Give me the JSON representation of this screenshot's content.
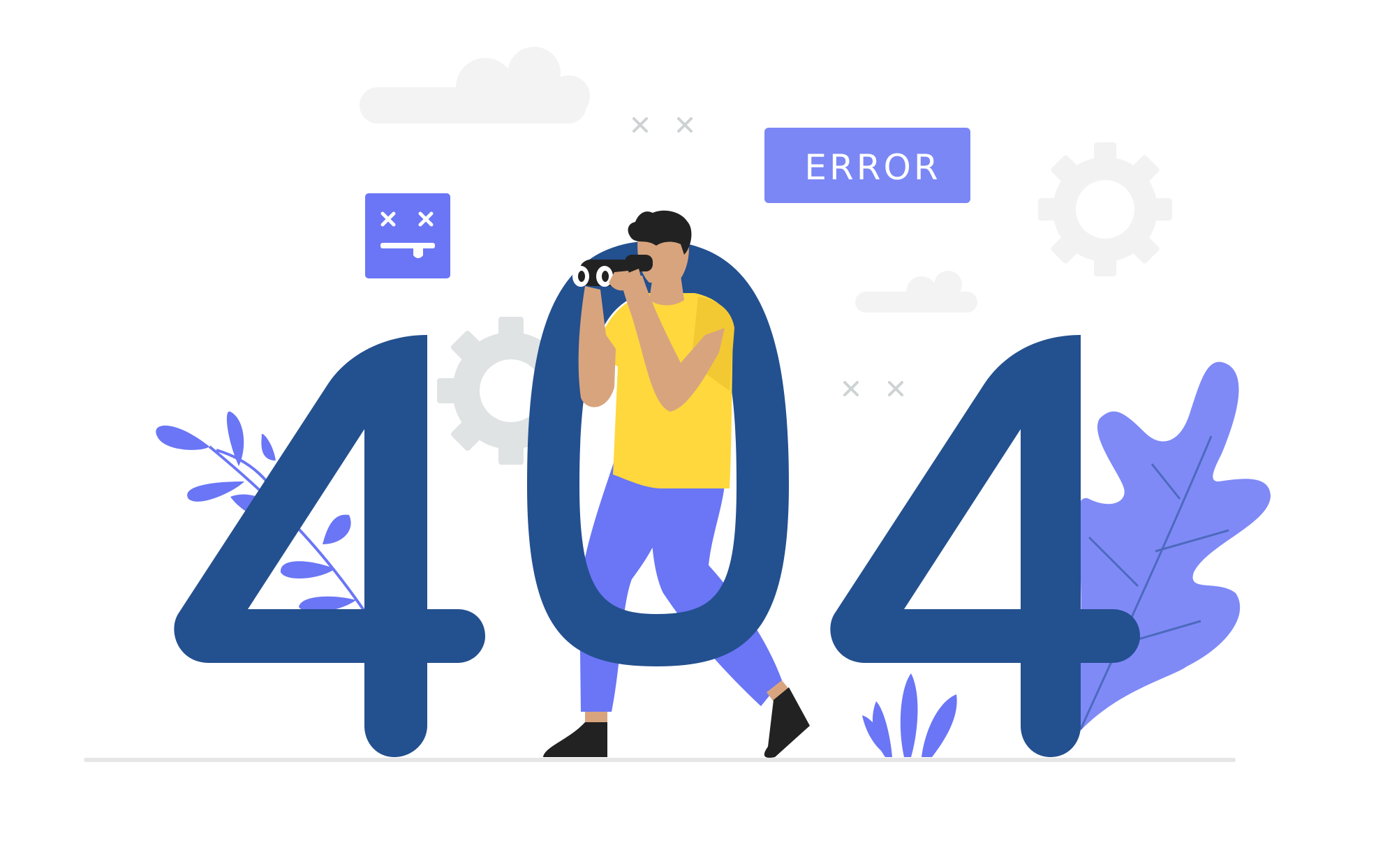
{
  "badge": {
    "label": "ERROR"
  },
  "error_code": {
    "digits": [
      "4",
      "0",
      "4"
    ]
  },
  "colors": {
    "navy": "#23508f",
    "periwinkle": "#6a76f5",
    "leaf_light": "#7f8af7",
    "yellow": "#fed83d",
    "skin": "#d8a47e",
    "hair": "#222222",
    "gear_gray": "#dfe3e4",
    "gear_light": "#f2f2f2",
    "cloud": "#f3f3f3",
    "ground": "#e6e6e6"
  },
  "icons": {
    "sad_face": "dead-face-monitor-icon",
    "gear": "gear-icon",
    "cloud": "cloud-icon",
    "sparkle": "x-sparkle-icon",
    "binoculars": "binoculars-icon"
  }
}
